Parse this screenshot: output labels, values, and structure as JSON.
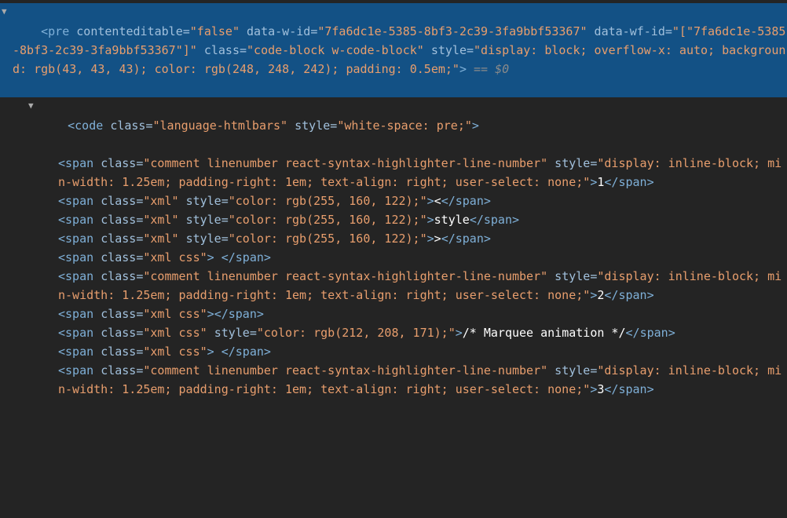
{
  "line1": {
    "tag": "pre",
    "attrs": [
      {
        "name": "contenteditable",
        "val": "\"false\""
      },
      {
        "name": "data-w-id",
        "val": "\"7fa6dc1e-5385-8bf3-2c39-3fa9bbf53367\""
      },
      {
        "name": "data-wf-id",
        "val": "\"[\"7fa6dc1e-5385-8bf3-2c39-3fa9bbf53367\"]\""
      },
      {
        "name": "class",
        "val": "\"code-block w-code-block\""
      },
      {
        "name": "style",
        "val": "\"display: block; overflow-x: auto; background: rgb(43, 43, 43); color: rgb(248, 248, 242); padding: 0.5em;\""
      }
    ],
    "eq0": " == $0"
  },
  "line2": {
    "tag": "code",
    "attrs": [
      {
        "name": "class",
        "val": "\"language-htmlbars\""
      },
      {
        "name": "style",
        "val": "\"white-space: pre;\""
      }
    ]
  },
  "spans": [
    {
      "attrs": [
        {
          "name": "class",
          "val": "\"comment linenumber react-syntax-highlighter-line-number\""
        },
        {
          "name": "style",
          "val": "\"display: inline-block; min-width: 1.25em; padding-right: 1em; text-align: right; user-select: none;\""
        }
      ],
      "text": "1"
    },
    {
      "attrs": [
        {
          "name": "class",
          "val": "\"xml\""
        },
        {
          "name": "style",
          "val": "\"color: rgb(255, 160, 122);\""
        }
      ],
      "text": "<"
    },
    {
      "attrs": [
        {
          "name": "class",
          "val": "\"xml\""
        },
        {
          "name": "style",
          "val": "\"color: rgb(255, 160, 122);\""
        }
      ],
      "text": "style"
    },
    {
      "attrs": [
        {
          "name": "class",
          "val": "\"xml\""
        },
        {
          "name": "style",
          "val": "\"color: rgb(255, 160, 122);\""
        }
      ],
      "text": ">"
    },
    {
      "attrs": [
        {
          "name": "class",
          "val": "\"xml css\""
        }
      ],
      "text": " "
    },
    {
      "attrs": [
        {
          "name": "class",
          "val": "\"comment linenumber react-syntax-highlighter-line-number\""
        },
        {
          "name": "style",
          "val": "\"display: inline-block; min-width: 1.25em; padding-right: 1em; text-align: right; user-select: none;\""
        }
      ],
      "text": "2"
    },
    {
      "attrs": [
        {
          "name": "class",
          "val": "\"xml css\""
        }
      ],
      "text": ""
    },
    {
      "attrs": [
        {
          "name": "class",
          "val": "\"xml css\""
        },
        {
          "name": "style",
          "val": "\"color: rgb(212, 208, 171);\""
        }
      ],
      "text": "/* Marquee animation */"
    },
    {
      "attrs": [
        {
          "name": "class",
          "val": "\"xml css\""
        }
      ],
      "text": " "
    },
    {
      "attrs": [
        {
          "name": "class",
          "val": "\"comment linenumber react-syntax-highlighter-line-number\""
        },
        {
          "name": "style",
          "val": "\"display: inline-block; min-width: 1.25em; padding-right: 1em; text-align: right; user-select: none;\""
        }
      ],
      "text": "3"
    }
  ],
  "spanTag": "span"
}
